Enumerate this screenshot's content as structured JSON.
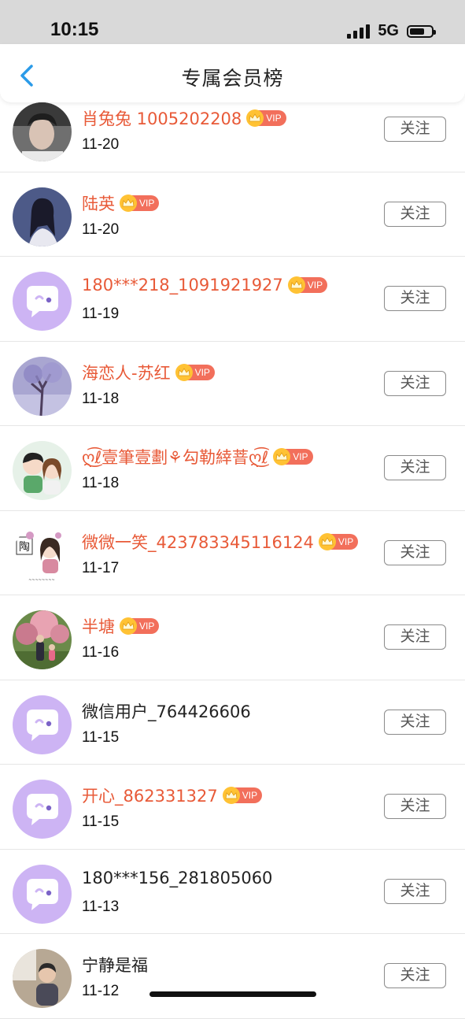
{
  "status": {
    "time": "10:15",
    "network": "5G"
  },
  "header": {
    "title": "专属会员榜"
  },
  "vip_label": "VIP",
  "follow_label": "关注",
  "members": [
    {
      "name": "肖兔兔 1005202208",
      "date": "11-20",
      "vip": true,
      "avatar": "photo-man"
    },
    {
      "name": "陆英",
      "date": "11-20",
      "vip": true,
      "avatar": "photo-girl"
    },
    {
      "name": "180***218_1091921927",
      "date": "11-19",
      "vip": true,
      "avatar": "default-chat"
    },
    {
      "name": "海恋人-苏红",
      "date": "11-18",
      "vip": true,
      "avatar": "photo-tree"
    },
    {
      "name": "ღ͜͡ℓ壹筆壹劃⚘勾勒緈萻ღ͜͡ℓ",
      "date": "11-18",
      "vip": true,
      "avatar": "cartoon-couple"
    },
    {
      "name": "微微一笑_423783345116124",
      "date": "11-17",
      "vip": true,
      "avatar": "cartoon-girl"
    },
    {
      "name": "半塘",
      "date": "11-16",
      "vip": true,
      "avatar": "photo-blossom"
    },
    {
      "name": "微信用户_764426606",
      "date": "11-15",
      "vip": false,
      "avatar": "default-chat"
    },
    {
      "name": "开心_862331327",
      "date": "11-15",
      "vip": true,
      "avatar": "default-chat"
    },
    {
      "name": "180***156_281805060",
      "date": "11-13",
      "vip": false,
      "avatar": "default-chat"
    },
    {
      "name": "宁静是福",
      "date": "11-12",
      "vip": false,
      "avatar": "photo-child"
    }
  ],
  "colors": {
    "vip_name": "#e85a38",
    "accent": "#2b9be8",
    "default_avatar": "#cdb4f4"
  }
}
